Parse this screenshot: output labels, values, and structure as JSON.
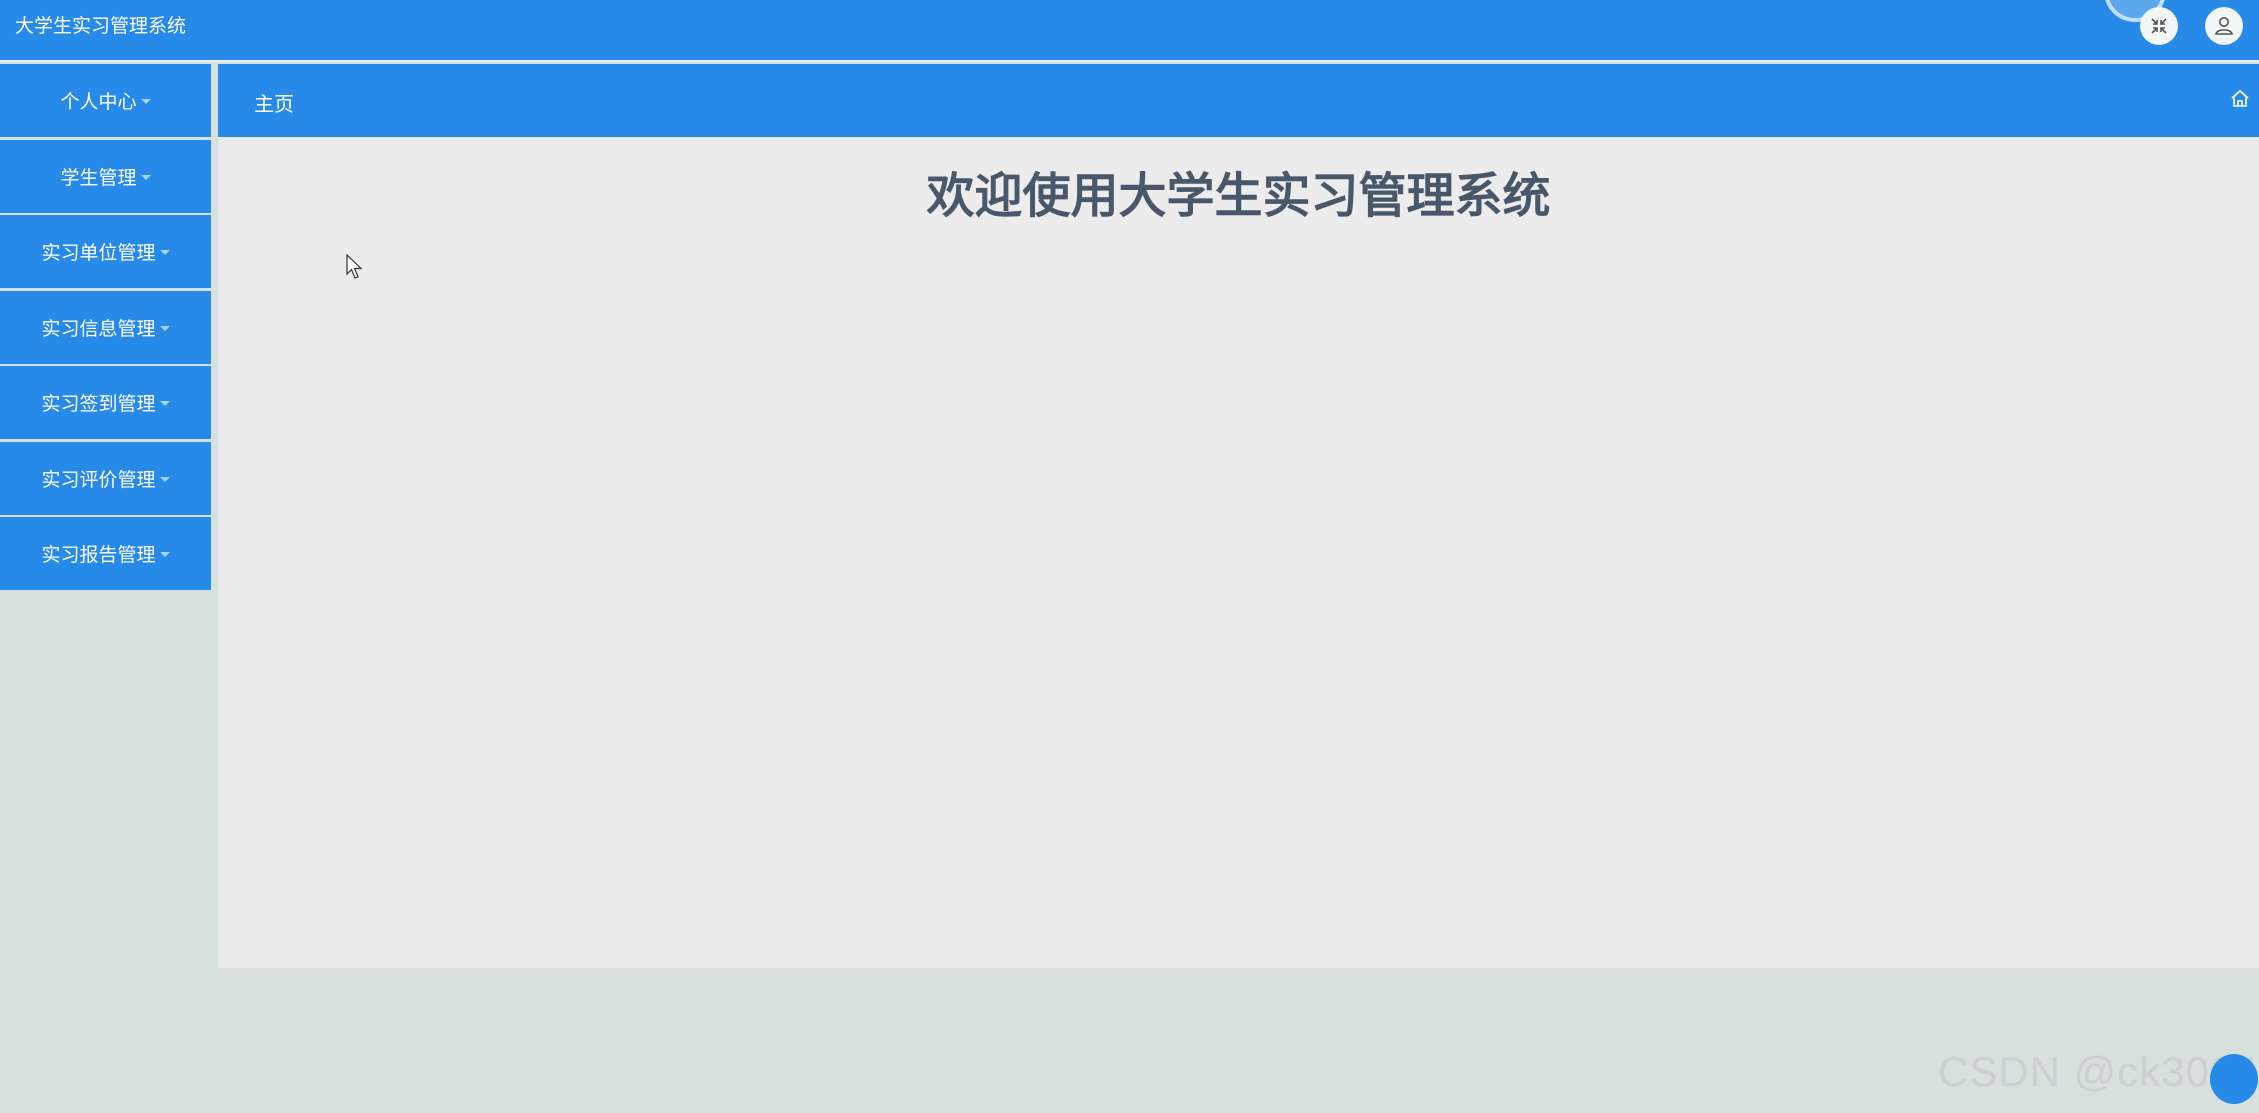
{
  "app": {
    "title": "大学生实习管理系统"
  },
  "header": {
    "fullscreen_icon": "fullscreen-exit-icon",
    "user_icon": "user-icon"
  },
  "sidebar": {
    "items": [
      {
        "label": "个人中心"
      },
      {
        "label": "学生管理"
      },
      {
        "label": "实习单位管理"
      },
      {
        "label": "实习信息管理"
      },
      {
        "label": "实习签到管理"
      },
      {
        "label": "实习评价管理"
      },
      {
        "label": "实习报告管理"
      }
    ]
  },
  "main": {
    "breadcrumb": "主页",
    "home_icon": "home-icon",
    "welcome": "欢迎使用大学生实习管理系统"
  },
  "watermark": "CSDN @ck3024",
  "colors": {
    "primary": "#288ae8",
    "page_bg": "#d6e0dc",
    "content_bg": "#ececec",
    "heading": "#48586a"
  }
}
